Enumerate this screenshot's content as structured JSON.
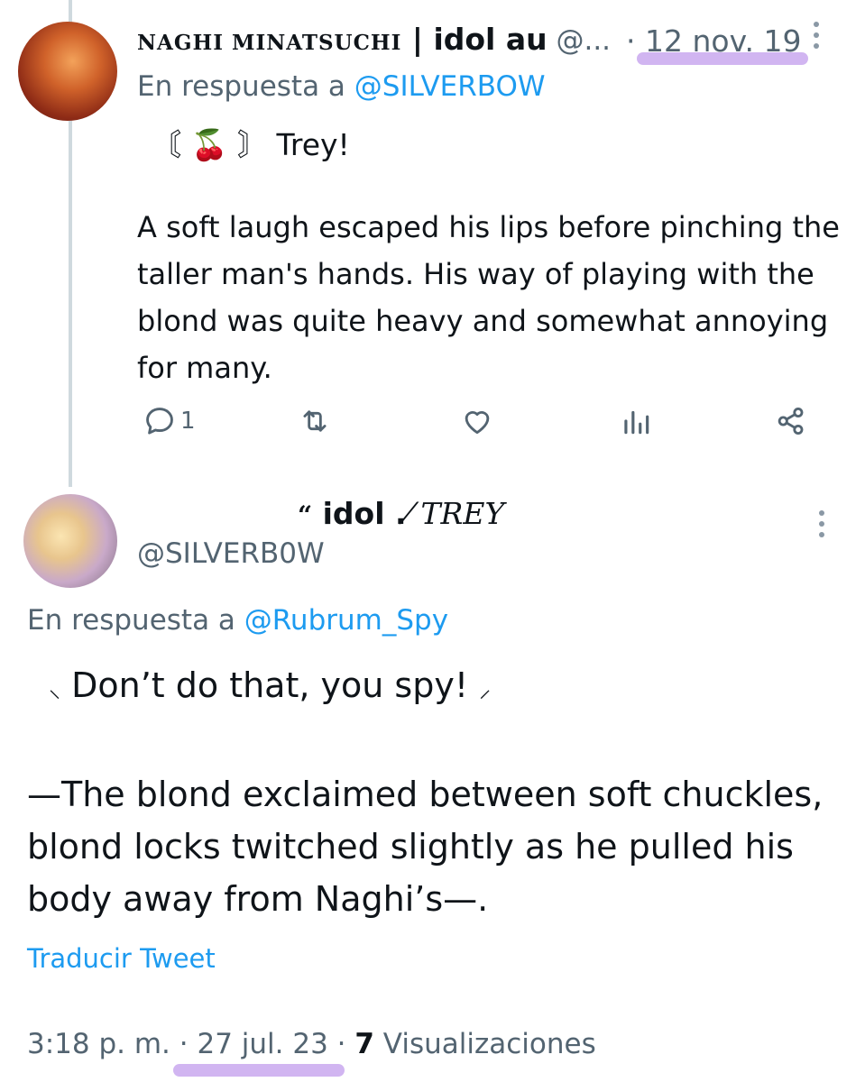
{
  "tweet1": {
    "display_name_part1": "NAGHI MINATSUCHI",
    "display_name_part2": " | idol au",
    "handle": " @...",
    "date": "· 12 nov. 19",
    "reply_prefix": "En respuesta a ",
    "reply_to": "@SILVERBOW",
    "first_line_decor": "〘 🍒 〙 Trey!",
    "body": "A soft laugh escaped his lips before pinching the taller man's hands.  His way of playing with the blond was quite heavy and somewhat annoying for many.",
    "reply_count": "1",
    "icons": [
      "reply-icon",
      "retweet-icon",
      "heart-icon",
      "views-icon",
      "share-icon"
    ]
  },
  "tweet2": {
    "display_name_quote": "“",
    "display_name_bold": " idol .",
    "display_name_italic": "⁄ TREY",
    "handle": "@SILVERB0W",
    "reply_prefix": "En respuesta a ",
    "reply_to": "@Rubrum_Spy",
    "spark_left": "⸜",
    "first_line": " Don’t do that, you spy! ",
    "spark_right": "⸝",
    "body": "—The blond exclaimed between soft chuckles, blond locks twitched slightly as he pulled his body away from Naghi’s—.",
    "translate": "Traducir Tweet",
    "time": "3:18 p. m. ",
    "date": "· 27 jul. 23",
    "views_sep": " · ",
    "views_count": "7",
    "views_label": " Visualizaciones"
  },
  "colors": {
    "accent": "#1d9bf0",
    "muted": "#536471",
    "highlight": "#c9a8ee"
  }
}
